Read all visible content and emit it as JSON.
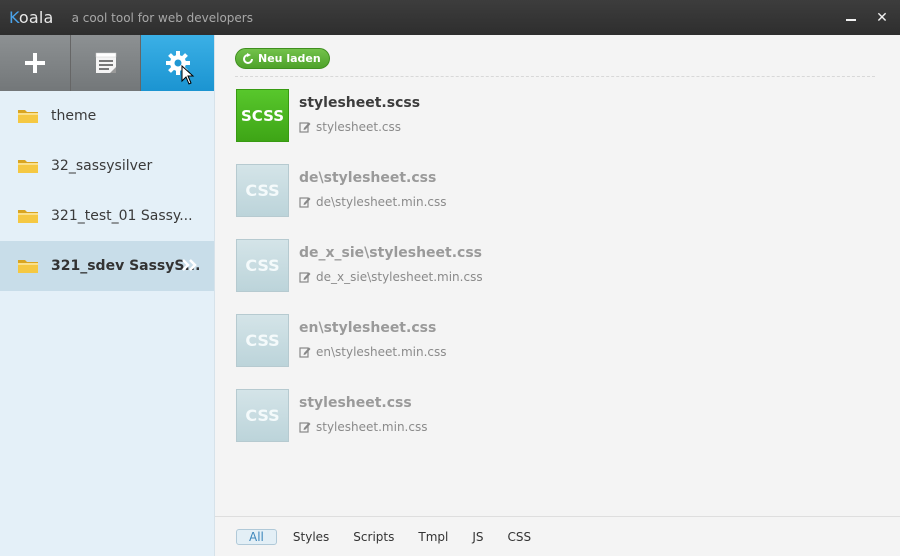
{
  "window": {
    "title_k": "K",
    "title_rest": "oala",
    "tagline": "a cool tool for web developers"
  },
  "sidebar": {
    "projects": [
      {
        "label": "theme"
      },
      {
        "label": "32_sassysilver"
      },
      {
        "label": "321_test_01 Sassy..."
      },
      {
        "label": "321_sdev SassyS..."
      }
    ]
  },
  "main": {
    "refresh_label": "Neu laden",
    "files": [
      {
        "type": "SCSS",
        "name": "stylesheet.scss",
        "output": "stylesheet.css"
      },
      {
        "type": "CSS",
        "name": "de\\stylesheet.css",
        "output": "de\\stylesheet.min.css"
      },
      {
        "type": "CSS",
        "name": "de_x_sie\\stylesheet.css",
        "output": "de_x_sie\\stylesheet.min.css"
      },
      {
        "type": "CSS",
        "name": "en\\stylesheet.css",
        "output": "en\\stylesheet.min.css"
      },
      {
        "type": "CSS",
        "name": "stylesheet.css",
        "output": "stylesheet.min.css"
      }
    ]
  },
  "footer": {
    "filters": [
      {
        "label": "All"
      },
      {
        "label": "Styles"
      },
      {
        "label": "Scripts"
      },
      {
        "label": "Tmpl"
      },
      {
        "label": "JS"
      },
      {
        "label": "CSS"
      }
    ]
  },
  "icons": {
    "add": "plus-icon",
    "log": "log-icon",
    "settings": "gear-icon",
    "folder": "folder-icon",
    "refresh": "refresh-icon",
    "edit": "edit-icon"
  },
  "colors": {
    "accent": "#1b94d1",
    "scss_badge": "#3ea516",
    "css_badge": "#bcd4da",
    "refresh_button": "#4ea22a"
  }
}
